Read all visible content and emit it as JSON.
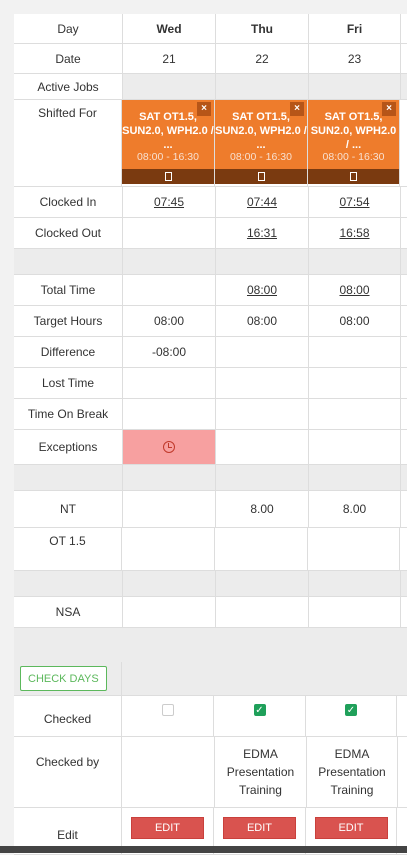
{
  "labels": {
    "day": "Day",
    "date": "Date",
    "active_jobs": "Active Jobs",
    "shifted_for": "Shifted For",
    "clocked_in": "Clocked In",
    "clocked_out": "Clocked Out",
    "total_time": "Total Time",
    "target_hours": "Target Hours",
    "difference": "Difference",
    "lost_time": "Lost Time",
    "time_on_break": "Time On Break",
    "exceptions": "Exceptions",
    "nt": "NT",
    "ot15": "OT 1.5",
    "nsa": "NSA",
    "checked": "Checked",
    "checked_by": "Checked by",
    "edit": "Edit"
  },
  "check_days_label": "CHECK DAYS",
  "days": [
    {
      "day": "Wed",
      "date": "21",
      "job": "SAT OT1.5, SUN2.0, WPH2.0 / ...",
      "job_time": "08:00 - 16:30",
      "clocked_in": "07:45",
      "clocked_out": "",
      "total_time": "",
      "target_hours": "08:00",
      "difference": "-08:00",
      "nt": "",
      "checked": false,
      "checked_by": "",
      "edit_label": "EDIT"
    },
    {
      "day": "Thu",
      "date": "22",
      "job": "SAT OT1.5, SUN2.0, WPH2.0 / ...",
      "job_time": "08:00 - 16:30",
      "clocked_in": "07:44",
      "clocked_out": "16:31",
      "total_time": "08:00",
      "target_hours": "08:00",
      "difference": "",
      "nt": "8.00",
      "checked": true,
      "checked_by": "EDMA Presentation Training",
      "edit_label": "EDIT"
    },
    {
      "day": "Fri",
      "date": "23",
      "job": "SAT OT1.5, SUN2.0, WPH2.0 / ...",
      "job_time": "08:00 - 16:30",
      "clocked_in": "07:54",
      "clocked_out": "16:58",
      "total_time": "08:00",
      "target_hours": "08:00",
      "difference": "",
      "nt": "8.00",
      "checked": true,
      "checked_by": "EDMA Presentation Training",
      "edit_label": "EDIT"
    }
  ],
  "colors": {
    "job_orange": "#ee7c2c",
    "exception": "#f7a0a0",
    "edit_red": "#d9534f",
    "check_green": "#5cb85c"
  }
}
